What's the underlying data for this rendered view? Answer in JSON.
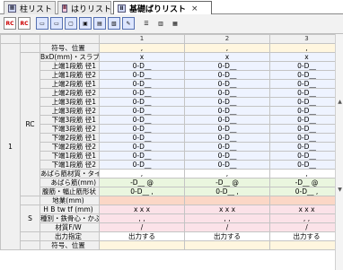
{
  "tabs": [
    {
      "icon": "grid",
      "label": "柱リスト"
    },
    {
      "icon": "grid",
      "label": "はりリスト"
    },
    {
      "icon": "grid",
      "label": "基礎ばりリスト",
      "close": "×"
    }
  ],
  "toolbar": {
    "buttons": [
      {
        "text": "RC"
      },
      {
        "text": "RC"
      }
    ]
  },
  "grid": {
    "columns": [
      "1",
      "2",
      "3"
    ],
    "group_main": "1",
    "group_rc": "RC",
    "group_s": "S",
    "rows": [
      {
        "label": "符号、位置",
        "cells": [
          ",",
          ",",
          ","
        ]
      },
      {
        "label": "BxD(mm)・スラブ",
        "cells": [
          "x",
          "x",
          "x"
        ]
      },
      {
        "label": "上端1段筋 径1",
        "cells": [
          "0-D__",
          "0-D__",
          "0-D__"
        ]
      },
      {
        "label": "上端1段筋 径2",
        "cells": [
          "0-D__",
          "0-D__",
          "0-D__"
        ]
      },
      {
        "label": "上端2段筋 径1",
        "cells": [
          "0-D__",
          "0-D__",
          "0-D__"
        ]
      },
      {
        "label": "上端2段筋 径2",
        "cells": [
          "0-D__",
          "0-D__",
          "0-D__"
        ]
      },
      {
        "label": "上端3段筋 径1",
        "cells": [
          "0-D__",
          "0-D__",
          "0-D__"
        ]
      },
      {
        "label": "上端3段筋 径2",
        "cells": [
          "0-D__",
          "0-D__",
          "0-D__"
        ]
      },
      {
        "label": "下端3段筋 径1",
        "cells": [
          "0-D__",
          "0-D__",
          "0-D__"
        ]
      },
      {
        "label": "下端3段筋 径2",
        "cells": [
          "0-D__",
          "0-D__",
          "0-D__"
        ]
      },
      {
        "label": "下端2段筋 径1",
        "cells": [
          "0-D__",
          "0-D__",
          "0-D__"
        ]
      },
      {
        "label": "下端2段筋 径2",
        "cells": [
          "0-D__",
          "0-D__",
          "0-D__"
        ]
      },
      {
        "label": "下端1段筋 径1",
        "cells": [
          "0-D__",
          "0-D__",
          "0-D__"
        ]
      },
      {
        "label": "下端1段筋 径2",
        "cells": [
          "0-D__",
          "0-D__",
          "0-D__"
        ]
      },
      {
        "label": "あばら筋材質・タイプ",
        "cells": [
          ",",
          ",",
          ","
        ]
      },
      {
        "label": "あばら筋(mm)",
        "cells": [
          "-D__ @",
          "-D__ @",
          "-D__ @"
        ]
      },
      {
        "label": "腹筋・幅止筋形状",
        "cells": [
          "0-D__ ,",
          "0-D__ ,",
          "0-D__ ,"
        ]
      },
      {
        "label": "地業(mm)",
        "cells": [
          "",
          "",
          ""
        ]
      },
      {
        "label": "H B tw tf (mm)",
        "cells": [
          "x x x",
          "x x x",
          "x x x"
        ]
      },
      {
        "label": "種別・鉄骨心・かぶり",
        "cells": [
          ", ,",
          ", ,",
          ", ,"
        ]
      },
      {
        "label": "材質F/W",
        "cells": [
          "/",
          "/",
          "/"
        ]
      },
      {
        "label": "出力指定",
        "cells": [
          "出力する",
          "出力する",
          "出力する"
        ]
      },
      {
        "label": "符号、位置",
        "cells": [
          "",
          "",
          ""
        ]
      }
    ]
  }
}
